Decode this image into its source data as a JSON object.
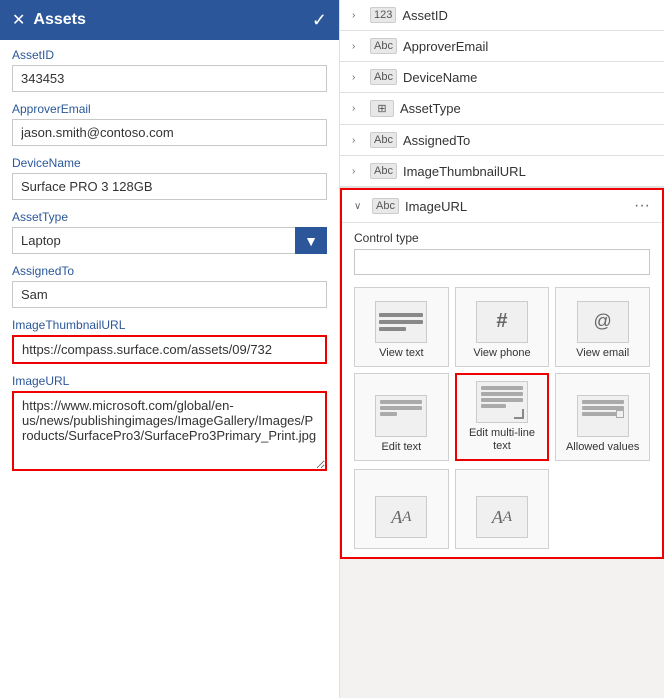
{
  "header": {
    "title": "Assets",
    "close_label": "✕",
    "check_label": "✓"
  },
  "left_panel": {
    "fields": [
      {
        "label": "AssetID",
        "value": "343453",
        "type": "input",
        "highlighted": false
      },
      {
        "label": "ApproverEmail",
        "value": "jason.smith@contoso.com",
        "type": "input",
        "highlighted": false
      },
      {
        "label": "DeviceName",
        "value": "Surface PRO 3 128GB",
        "type": "input",
        "highlighted": false
      },
      {
        "label": "AssetType",
        "value": "Laptop",
        "type": "select",
        "highlighted": false
      },
      {
        "label": "AssignedTo",
        "value": "Sam",
        "type": "input",
        "highlighted": false
      },
      {
        "label": "ImageThumbnailURL",
        "value": "https://compass.surface.com/assets/09/732",
        "type": "input",
        "highlighted": true
      },
      {
        "label": "ImageURL",
        "value": "https://www.microsoft.com/global/en-us/news/publishingimages/ImageGallery/Images/Products/SurfacePro3/SurfacePro3Primary_Print.jpg",
        "type": "textarea",
        "highlighted": true
      }
    ]
  },
  "right_panel": {
    "field_list": [
      {
        "name": "AssetID",
        "type_icon": "123",
        "expanded": false
      },
      {
        "name": "ApproverEmail",
        "type_icon": "Abc",
        "expanded": false
      },
      {
        "name": "DeviceName",
        "type_icon": "Abc",
        "expanded": false
      },
      {
        "name": "AssetType",
        "type_icon": "⊞",
        "expanded": false
      },
      {
        "name": "AssignedTo",
        "type_icon": "Abc",
        "expanded": false
      },
      {
        "name": "ImageThumbnailURL",
        "type_icon": "Abc",
        "expanded": false
      }
    ],
    "imageurl_field": {
      "name": "ImageURL",
      "type_icon": "Abc",
      "expanded": true,
      "more_icon": "···",
      "control_type_label": "Control type",
      "control_type_value": ""
    },
    "control_options": [
      {
        "id": "view-text",
        "label": "View text",
        "selected": false
      },
      {
        "id": "view-phone",
        "label": "View phone",
        "selected": false
      },
      {
        "id": "view-email",
        "label": "View email",
        "selected": false
      },
      {
        "id": "edit-text",
        "label": "Edit text",
        "selected": false
      },
      {
        "id": "edit-multi-line",
        "label": "Edit multi-line text",
        "selected": true
      },
      {
        "id": "allowed-values",
        "label": "Allowed values",
        "selected": false
      }
    ],
    "bottom_options": [
      {
        "id": "text-aa1",
        "label": "AA",
        "selected": false
      },
      {
        "id": "text-aa2",
        "label": "AA",
        "selected": false
      }
    ]
  }
}
